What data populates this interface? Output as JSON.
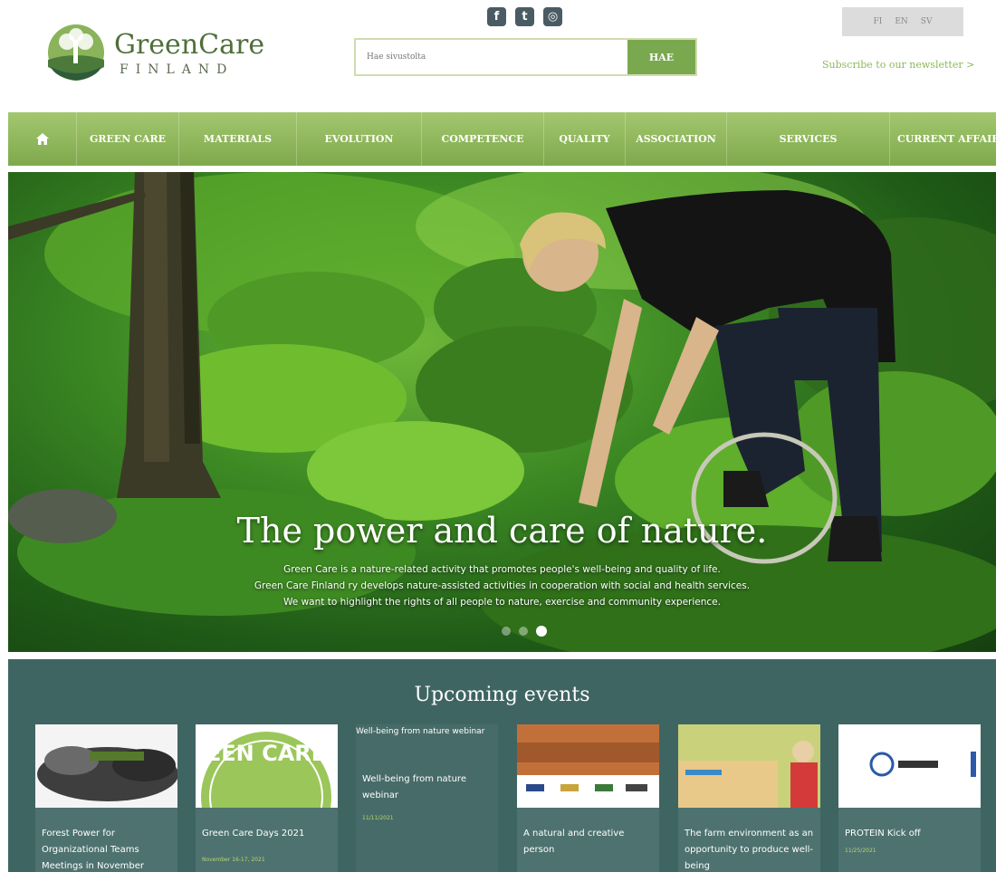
{
  "logo": {
    "title": "GreenCare",
    "subtitle": "FINLAND"
  },
  "social": [
    {
      "icon": "facebook-icon",
      "glyph": "f"
    },
    {
      "icon": "twitter-icon",
      "glyph": "t"
    },
    {
      "icon": "instagram-icon",
      "glyph": "◎"
    }
  ],
  "search": {
    "placeholder": "Hae sivustolta",
    "button_label": "HAE"
  },
  "languages": [
    "FI",
    "EN",
    "SV"
  ],
  "newsletter_link": "Subscribe to our newsletter >",
  "nav": {
    "home_icon": "home-icon",
    "items": [
      "GREEN CARE",
      "MATERIALS",
      "EVOLUTION",
      "COMPETENCE",
      "QUALITY",
      "ASSOCIATION",
      "SERVICES",
      "CURRENT AFFAIRS"
    ]
  },
  "hero": {
    "title": "The power and care of nature.",
    "lines": [
      "Green Care is a nature-related activity that promotes people's well-being and quality of life.",
      "Green Care Finland ry develops nature-assisted activities in cooperation with social and health services.",
      "We want to highlight the rights of all people to nature, exercise and community experience."
    ],
    "slide_count": 3,
    "active_slide": 3
  },
  "events": {
    "title": "Upcoming events",
    "items": [
      {
        "title": "Forest Power for Organizational Teams Meetings in November",
        "date": ""
      },
      {
        "title": "Green Care Days 2021",
        "date": "November 16-17, 2021"
      },
      {
        "image_alt": "Well-being from nature webinar",
        "title": "Well-being from nature webinar",
        "date": "11/11/2021"
      },
      {
        "title": "A natural and creative person",
        "date": ""
      },
      {
        "title": "The farm environment as an opportunity to produce well-being",
        "date": ""
      },
      {
        "title": "PROTEIN Kick off",
        "date": "11/25/2021"
      }
    ]
  }
}
